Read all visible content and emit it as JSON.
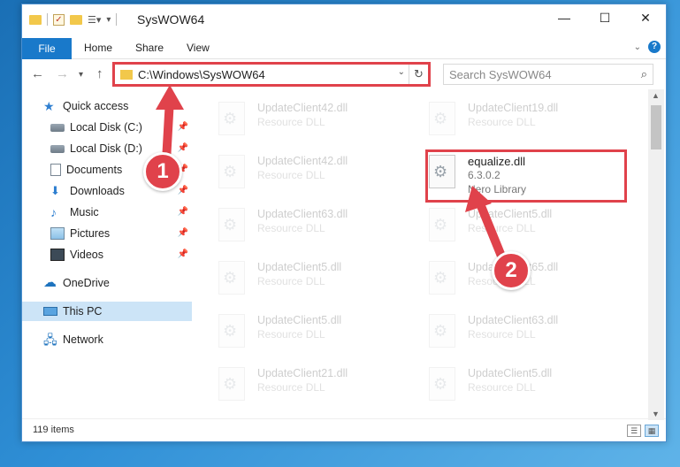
{
  "window": {
    "title": "SysWOW64",
    "controls": {
      "minimize": "—",
      "maximize": "☐",
      "close": "✕"
    }
  },
  "ribbon": {
    "tabs": [
      "File",
      "Home",
      "Share",
      "View"
    ]
  },
  "address": {
    "path": "C:\\Windows\\SysWOW64"
  },
  "search": {
    "placeholder": "Search SysWOW64"
  },
  "sidebar": {
    "items": [
      {
        "label": "Quick access",
        "icon": "star-icon",
        "pinned": false
      },
      {
        "label": "Local Disk (C:)",
        "icon": "disk-icon",
        "pinned": true
      },
      {
        "label": "Local Disk (D:)",
        "icon": "disk-icon",
        "pinned": true
      },
      {
        "label": "Documents",
        "icon": "documents-icon",
        "pinned": true
      },
      {
        "label": "Downloads",
        "icon": "downloads-icon",
        "pinned": true
      },
      {
        "label": "Music",
        "icon": "music-icon",
        "pinned": true
      },
      {
        "label": "Pictures",
        "icon": "pictures-icon",
        "pinned": true
      },
      {
        "label": "Videos",
        "icon": "videos-icon",
        "pinned": true
      },
      {
        "label": "OneDrive",
        "icon": "onedrive-icon",
        "pinned": false
      },
      {
        "label": "This PC",
        "icon": "this-pc-icon",
        "pinned": false,
        "selected": true
      },
      {
        "label": "Network",
        "icon": "network-icon",
        "pinned": false
      }
    ]
  },
  "files": {
    "left": [
      {
        "name": "UpdateClient42.dll",
        "type": "Resource DLL"
      },
      {
        "name": "UpdateClient42.dll",
        "type": "Resource DLL"
      },
      {
        "name": "UpdateClient63.dll",
        "type": "Resource DLL"
      },
      {
        "name": "UpdateClient5.dll",
        "type": "Resource DLL"
      },
      {
        "name": "UpdateClient5.dll",
        "type": "Resource DLL"
      },
      {
        "name": "UpdateClient21.dll",
        "type": "Resource DLL"
      }
    ],
    "right": [
      {
        "name": "UpdateClient19.dll",
        "type": "Resource DLL"
      },
      {
        "name": "equalize.dll",
        "version": "6.3.0.2",
        "type": "Nero Library",
        "highlighted": true
      },
      {
        "name": "UpdateClient5.dll",
        "type": "Resource DLL"
      },
      {
        "name": "UpdateClient65.dll",
        "type": "Resource DLL"
      },
      {
        "name": "UpdateClient63.dll",
        "type": "Resource DLL"
      },
      {
        "name": "UpdateClient5.dll",
        "type": "Resource DLL"
      }
    ]
  },
  "status": {
    "item_count": "119 items"
  },
  "callouts": {
    "one": "1",
    "two": "2"
  },
  "colors": {
    "accent": "#1979ca",
    "highlight": "#e0424b",
    "selected": "#cce4f7"
  }
}
